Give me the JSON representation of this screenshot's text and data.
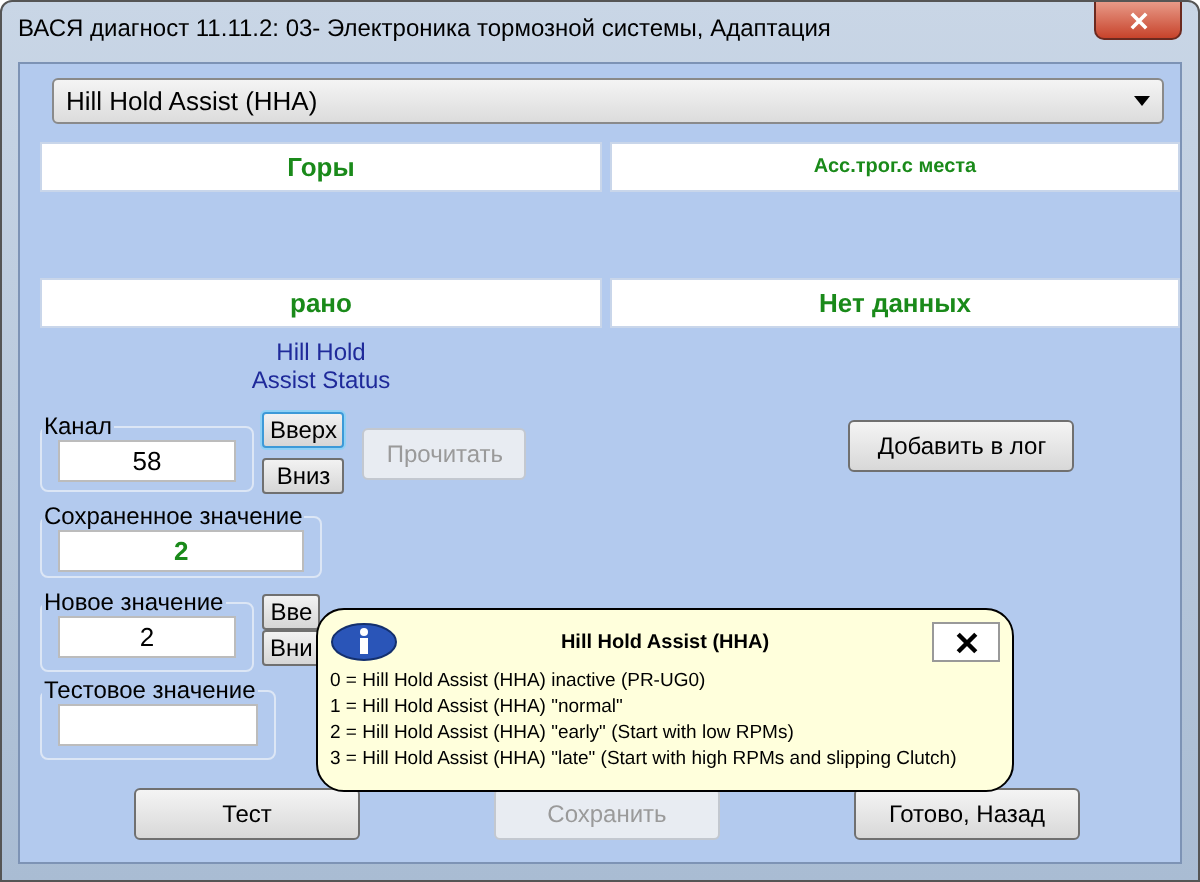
{
  "window": {
    "title": "ВАСЯ диагност 11.11.2: 03- Электроника тормозной системы, Адаптация"
  },
  "dropdown": {
    "value": "Hill Hold Assist (HHA)"
  },
  "status_cells": [
    {
      "text": "Горы",
      "kind": "large"
    },
    {
      "text": "Асс.трог.с места",
      "kind": "small"
    },
    {
      "text": "рано",
      "kind": "large"
    },
    {
      "text": "Нет данных",
      "kind": "large"
    }
  ],
  "caption": "Hill Hold\nAssist Status",
  "channel": {
    "label": "Канал",
    "value": "58",
    "buttons": [
      {
        "label": "Вверх",
        "focused": true
      },
      {
        "label": "Вниз",
        "focused": false
      }
    ]
  },
  "read_button": {
    "label": "Прочитать",
    "disabled": true
  },
  "log_button": {
    "label": "Добавить в лог",
    "disabled": false
  },
  "saved": {
    "label": "Сохраненное значение",
    "value": "2"
  },
  "new_value": {
    "label": "Новое значение",
    "value": "2",
    "buttons": [
      {
        "label": "Вве",
        "focused": false
      },
      {
        "label": "Вни",
        "focused": false
      }
    ]
  },
  "test_value": {
    "label": "Тестовое значение"
  },
  "bottom_buttons": [
    {
      "label": "Тест",
      "disabled": false
    },
    {
      "label": "Сохранить",
      "disabled": true
    },
    {
      "label": "Готово, Назад",
      "disabled": false
    }
  ],
  "tooltip": {
    "title": "Hill Hold Assist (HHA)",
    "lines": [
      "0 = Hill Hold Assist (HHA) inactive (PR-UG0)",
      "1 = Hill Hold Assist (HHA) \"normal\"",
      "2 = Hill Hold Assist (HHA) \"early\" (Start with low RPMs)",
      "3 = Hill Hold Assist (HHA) \"late\" (Start with high RPMs and slipping Clutch)"
    ]
  }
}
